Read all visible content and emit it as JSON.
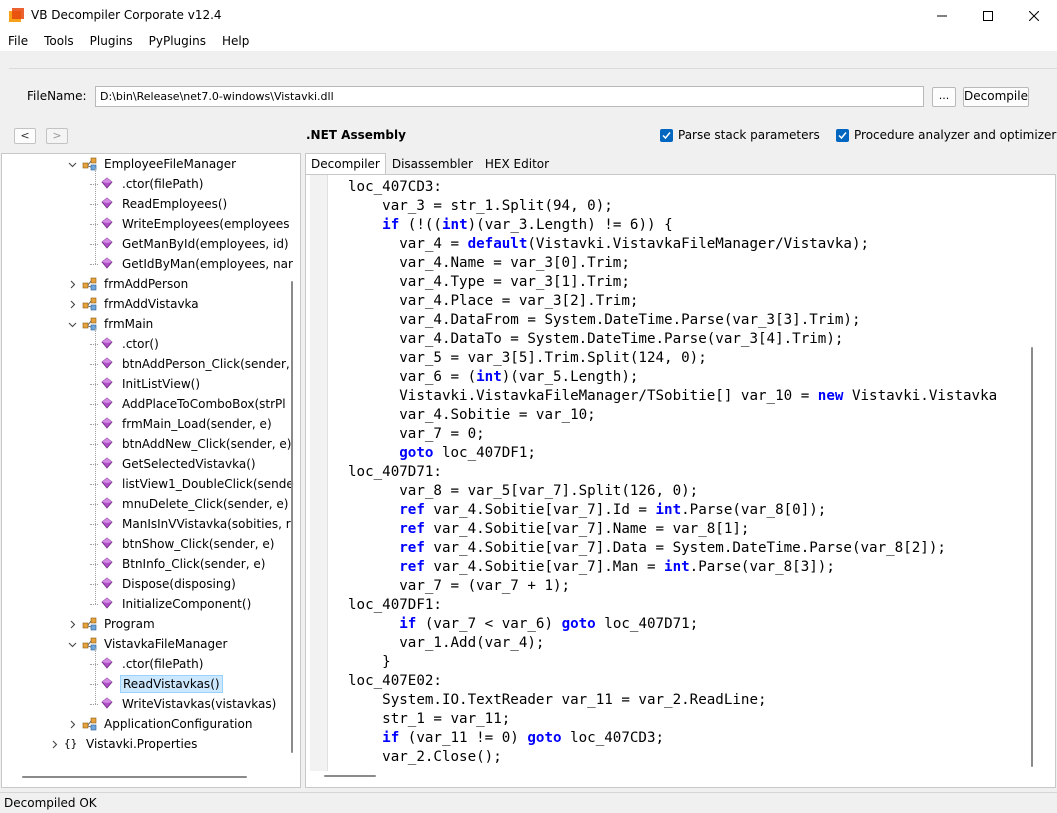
{
  "window": {
    "title": "VB Decompiler Corporate v12.4"
  },
  "menu": [
    "File",
    "Tools",
    "Plugins",
    "PyPlugins",
    "Help"
  ],
  "file": {
    "label": "FileName:",
    "value": "D:\\bin\\Release\\net7.0-windows\\Vistavki.dll",
    "browse_label": "...",
    "decompile_label": "Decompile"
  },
  "toolbar": {
    "back_label": "<",
    "forward_label": ">",
    "assembly_title": ".NET Assembly",
    "parse_stack_label": "Parse stack parameters",
    "parse_stack_checked": true,
    "procedure_analyzer_label": "Procedure analyzer and optimizer",
    "procedure_analyzer_checked": true
  },
  "tree": [
    {
      "label": "EmployeeFileManager",
      "type": "class",
      "level": 1,
      "expanded": true
    },
    {
      "label": ".ctor(filePath)",
      "type": "method",
      "level": 2
    },
    {
      "label": "ReadEmployees()",
      "type": "method",
      "level": 2
    },
    {
      "label": "WriteEmployees(employees",
      "type": "method",
      "level": 2
    },
    {
      "label": "GetManById(employees, id)",
      "type": "method",
      "level": 2
    },
    {
      "label": "GetIdByMan(employees, nar",
      "type": "method",
      "level": 2
    },
    {
      "label": "frmAddPerson",
      "type": "class",
      "level": 1,
      "expanded": false
    },
    {
      "label": "frmAddVistavka",
      "type": "class",
      "level": 1,
      "expanded": false
    },
    {
      "label": "frmMain",
      "type": "class",
      "level": 1,
      "expanded": true
    },
    {
      "label": ".ctor()",
      "type": "method",
      "level": 2
    },
    {
      "label": "btnAddPerson_Click(sender,",
      "type": "method",
      "level": 2
    },
    {
      "label": "InitListView()",
      "type": "method",
      "level": 2
    },
    {
      "label": "AddPlaceToComboBox(strPl",
      "type": "method",
      "level": 2
    },
    {
      "label": "frmMain_Load(sender, e)",
      "type": "method",
      "level": 2
    },
    {
      "label": "btnAddNew_Click(sender, e)",
      "type": "method",
      "level": 2
    },
    {
      "label": "GetSelectedVistavka()",
      "type": "method",
      "level": 2
    },
    {
      "label": "listView1_DoubleClick(sende",
      "type": "method",
      "level": 2
    },
    {
      "label": "mnuDelete_Click(sender, e)",
      "type": "method",
      "level": 2
    },
    {
      "label": "ManIsInVVistavka(sobities, r",
      "type": "method",
      "level": 2
    },
    {
      "label": "btnShow_Click(sender, e)",
      "type": "method",
      "level": 2
    },
    {
      "label": "BtnInfo_Click(sender, e)",
      "type": "method",
      "level": 2
    },
    {
      "label": "Dispose(disposing)",
      "type": "method",
      "level": 2
    },
    {
      "label": "InitializeComponent()",
      "type": "method",
      "level": 2
    },
    {
      "label": "Program",
      "type": "class",
      "level": 1,
      "expanded": false
    },
    {
      "label": "VistavkaFileManager",
      "type": "class",
      "level": 1,
      "expanded": true
    },
    {
      "label": ".ctor(filePath)",
      "type": "method",
      "level": 2
    },
    {
      "label": "ReadVistavkas()",
      "type": "method",
      "level": 2,
      "selected": true
    },
    {
      "label": "WriteVistavkas(vistavkas)",
      "type": "method",
      "level": 2
    },
    {
      "label": "ApplicationConfiguration",
      "type": "class",
      "level": 1,
      "expanded": false
    },
    {
      "label": "Vistavki.Properties",
      "type": "namespace",
      "level": 0,
      "expanded": false
    }
  ],
  "tabs": [
    {
      "label": "Decompiler",
      "active": true
    },
    {
      "label": "Disassembler",
      "active": false
    },
    {
      "label": "HEX Editor",
      "active": false
    }
  ],
  "code": [
    "loc_407CD3:",
    "    var_3 = str_1.Split(94, 0);",
    "    if (!((int)(var_3.Length) != 6)) {",
    "      var_4 = default(Vistavki.VistavkaFileManager/Vistavka);",
    "      var_4.Name = var_3[0].Trim;",
    "      var_4.Type = var_3[1].Trim;",
    "      var_4.Place = var_3[2].Trim;",
    "      var_4.DataFrom = System.DateTime.Parse(var_3[3].Trim);",
    "      var_4.DataTo = System.DateTime.Parse(var_3[4].Trim);",
    "      var_5 = var_3[5].Trim.Split(124, 0);",
    "      var_6 = (int)(var_5.Length);",
    "      Vistavki.VistavkaFileManager/TSobitie[] var_10 = new Vistavki.Vistavka",
    "      var_4.Sobitie = var_10;",
    "      var_7 = 0;",
    "      goto loc_407DF1;",
    "loc_407D71:",
    "      var_8 = var_5[var_7].Split(126, 0);",
    "      ref var_4.Sobitie[var_7].Id = int.Parse(var_8[0]);",
    "      ref var_4.Sobitie[var_7].Name = var_8[1];",
    "      ref var_4.Sobitie[var_7].Data = System.DateTime.Parse(var_8[2]);",
    "      ref var_4.Sobitie[var_7].Man = int.Parse(var_8[3]);",
    "      var_7 = (var_7 + 1);",
    "loc_407DF1:",
    "      if (var_7 < var_6) goto loc_407D71;",
    "      var_1.Add(var_4);",
    "    }",
    "loc_407E02:",
    "    System.IO.TextReader var_11 = var_2.ReadLine;",
    "    str_1 = var_11;",
    "    if (var_11 != 0) goto loc_407CD3;",
    "    var_2.Close();"
  ],
  "status": {
    "text": "Decompiled OK"
  },
  "colors": {
    "keyword": "#0000ff",
    "selection": "#cce8ff",
    "checkbox": "#0067c0"
  },
  "keywords": [
    "if",
    "int",
    "default",
    "new",
    "goto",
    "ref"
  ]
}
